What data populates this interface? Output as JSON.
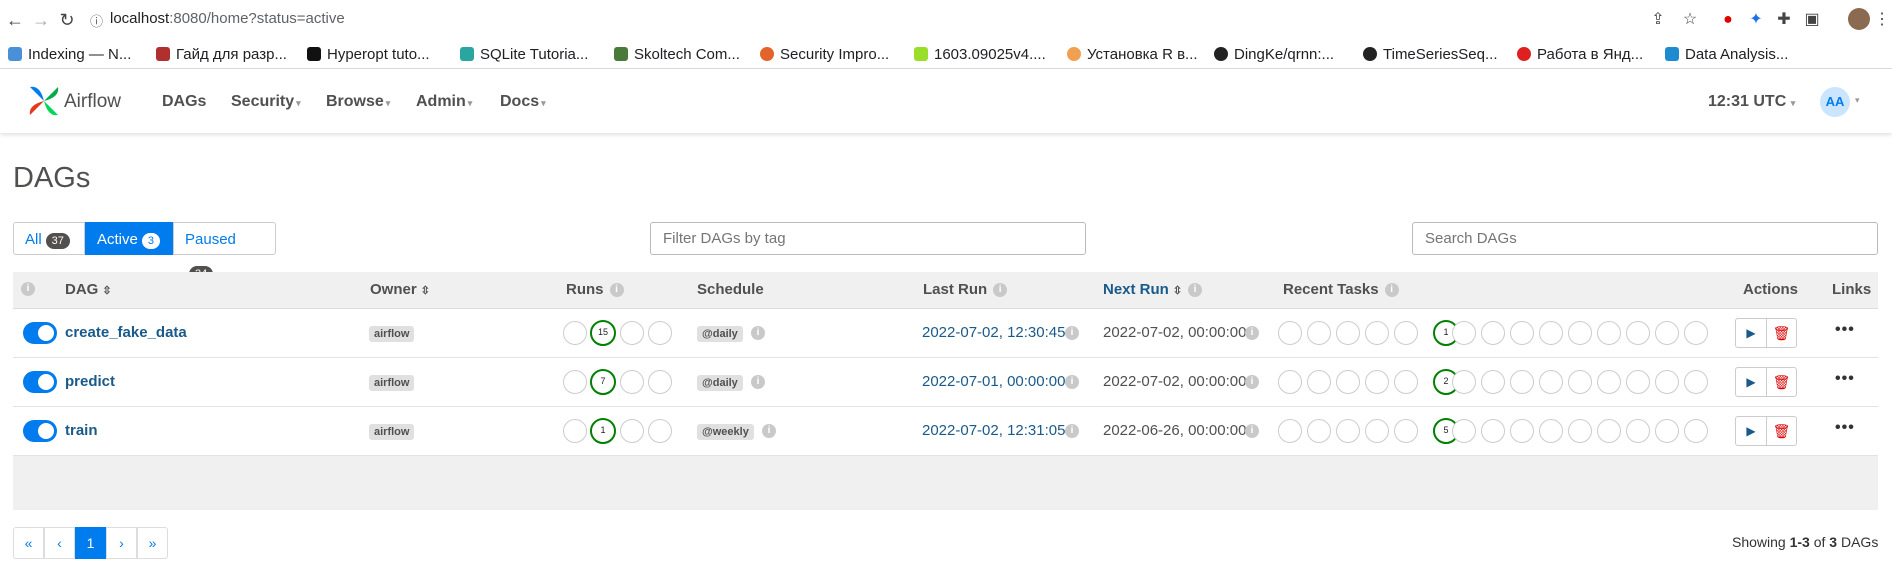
{
  "browser": {
    "url_host": "localhost",
    "url_path": ":8080/home?status=active",
    "bookmarks": [
      "Indexing — N...",
      "Гайд для разр...",
      "Hyperopt tuto...",
      "SQLite Tutoria...",
      "Skoltech Com...",
      "Security Impro...",
      "1603.09025v4....",
      "Установка R в...",
      "DingKe/qrnn:...",
      "TimeSeriesSeq...",
      "Работа в Янд...",
      "Data Analysis..."
    ]
  },
  "navbar": {
    "brand": "Airflow",
    "menu": [
      "DAGs",
      "Security",
      "Browse",
      "Admin",
      "Docs"
    ],
    "time": "12:31 UTC",
    "avatar": "AA"
  },
  "page": {
    "title": "DAGs",
    "filters": [
      {
        "label": "All",
        "count": "37"
      },
      {
        "label": "Active",
        "count": "3"
      },
      {
        "label": "Paused",
        "count": "34"
      }
    ],
    "tag_placeholder": "Filter DAGs by tag",
    "search_placeholder": "Search DAGs"
  },
  "table": {
    "headers": {
      "dag": "DAG",
      "owner": "Owner",
      "runs": "Runs",
      "schedule": "Schedule",
      "last_run": "Last Run",
      "next_run": "Next Run",
      "recent_tasks": "Recent Tasks",
      "actions": "Actions",
      "links": "Links"
    },
    "rows": [
      {
        "name": "create_fake_data",
        "owner": "airflow",
        "runs_success": "15",
        "schedule": "@daily",
        "last_run": "2022-07-02, 12:30:45",
        "next_run": "2022-07-02, 00:00:00",
        "task_success": "1"
      },
      {
        "name": "predict",
        "owner": "airflow",
        "runs_success": "7",
        "schedule": "@daily",
        "last_run": "2022-07-01, 00:00:00",
        "next_run": "2022-07-02, 00:00:00",
        "task_success": "2"
      },
      {
        "name": "train",
        "owner": "airflow",
        "runs_success": "1",
        "schedule": "@weekly",
        "last_run": "2022-07-02, 12:31:05",
        "next_run": "2022-06-26, 00:00:00",
        "task_success": "5"
      }
    ]
  },
  "pagination": {
    "first": "«",
    "prev": "‹",
    "current": "1",
    "next": "›",
    "last": "»",
    "showing_prefix": "Showing ",
    "showing_range": "1-3",
    "showing_of": " of ",
    "showing_total": "3",
    "showing_suffix": " DAGs"
  },
  "colors": {
    "accent": "#017cee",
    "success": "#008000",
    "link": "#1a5a8a"
  }
}
